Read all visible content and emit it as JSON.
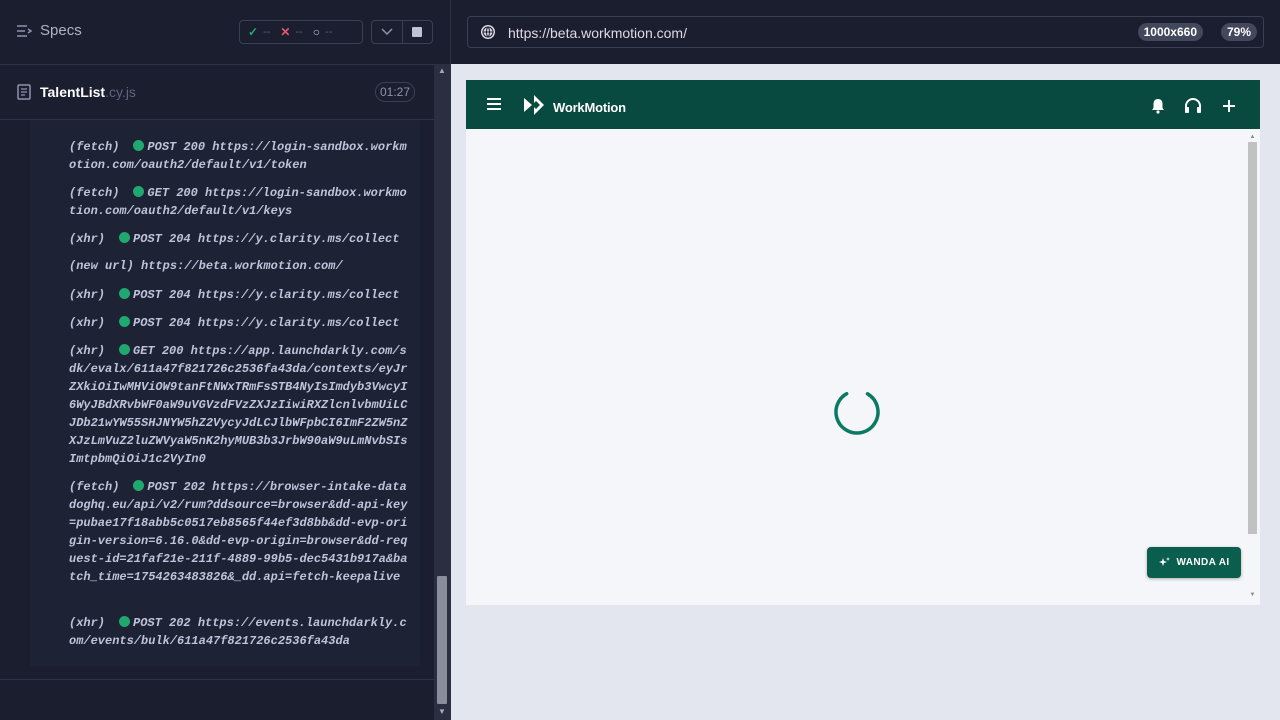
{
  "runner": {
    "specs_label": "Specs",
    "stats": {
      "passed": "--",
      "failed": "--",
      "pending": "--"
    },
    "file": {
      "name": "TalentList",
      "ext": ".cy.js",
      "duration": "01:27"
    },
    "log": [
      {
        "kind": "(fetch)",
        "status": "POST 200",
        "url": "https://login-sandbox.workmotion.com/oauth2/default/v1/token"
      },
      {
        "kind": "(fetch)",
        "status": "GET 200",
        "url": "https://login-sandbox.workmotion.com/oauth2/default/v1/keys"
      },
      {
        "kind": "(xhr)",
        "status": "POST 204",
        "url": "https://y.clarity.ms/collect"
      },
      {
        "kind": "(new url)",
        "status": "",
        "url": "https://beta.workmotion.com/"
      },
      {
        "kind": "(xhr)",
        "status": "POST 204",
        "url": "https://y.clarity.ms/collect"
      },
      {
        "kind": "(xhr)",
        "status": "POST 204",
        "url": "https://y.clarity.ms/collect"
      },
      {
        "kind": "(xhr)",
        "status": "GET 200",
        "url": "https://app.launchdarkly.com/sdk/evalx/611a47f821726c2536fa43da/contexts/eyJrZXkiOiIwMHViOW9tanFtNWxTRmFsSTB4NyIsImdyb3VwcyI6WyJBdXRvbWF0aW9uVGVzdFVzZXJzIiwiRXZlcnlvbmUiLCJDb21wYW55SHJNYW5hZ2VycyJdLCJlbWFpbCI6ImF2ZW5nZXJzLmVuZ2luZWVyaW5nK2hyMUB3b3JrbW90aW9uLmNvbSIsImtpbmQiOiJ1c2VyIn0"
      },
      {
        "kind": "(fetch)",
        "status": "POST 202",
        "url": "https://browser-intake-datadoghq.eu/api/v2/rum?ddsource=browser&dd-api-key=pubae17f18abb5c0517eb8565f44ef3d8bb&dd-evp-origin-version=6.16.0&dd-evp-origin=browser&dd-request-id=21faf21e-211f-4889-99b5-dec5431b917a&batch_time=1754263483826&_dd.api=fetch-keepalive"
      },
      {
        "kind": "(xhr)",
        "status": "POST 202",
        "url": "https://events.launchdarkly.com/events/bulk/611a47f821726c2536fa43da"
      }
    ]
  },
  "browser": {
    "url": "https://beta.workmotion.com/",
    "viewport": "1000x660",
    "zoom": "79%"
  },
  "app": {
    "brand": "WorkMotion",
    "wanda_label": "WANDA AI",
    "colors": {
      "header": "#084a3f",
      "accent": "#0a7a64"
    }
  }
}
